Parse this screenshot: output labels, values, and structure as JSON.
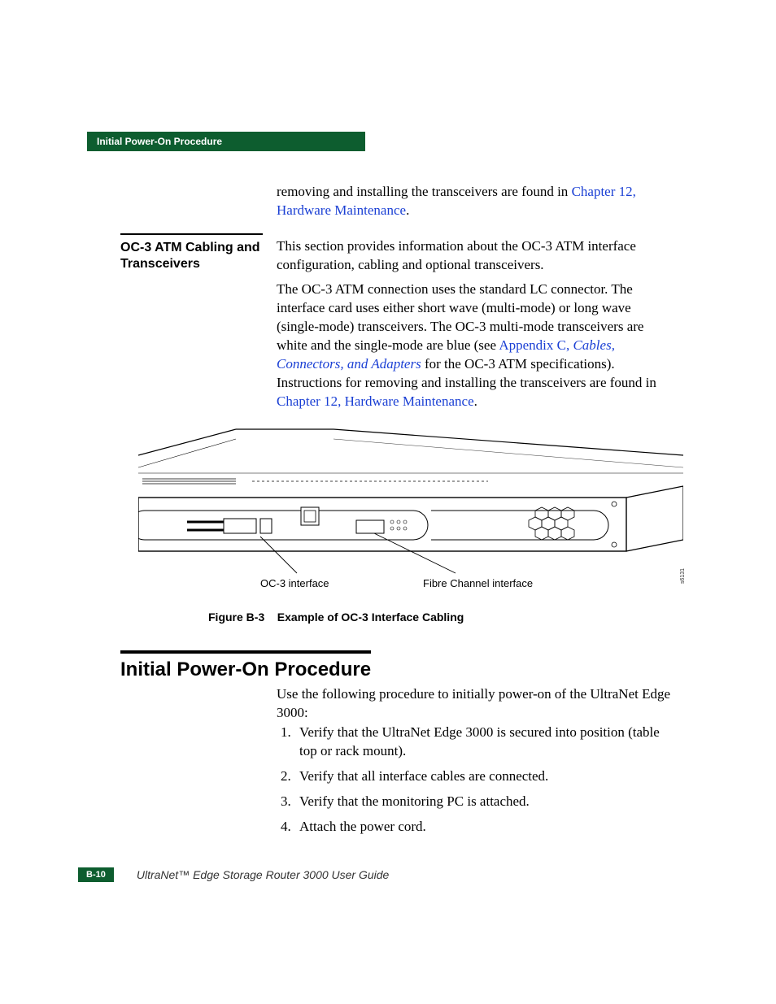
{
  "header": {
    "running_title": "Initial Power-On Procedure"
  },
  "p1": {
    "lead": "removing and installing the transceivers are found in ",
    "link": "Chapter 12, Hardware Maintenance",
    "tail": "."
  },
  "side_heading": "OC-3 ATM Cabling and Transceivers",
  "p2": "This section provides information about the OC-3 ATM interface configuration, cabling and optional transceivers.",
  "p3": {
    "a": "The OC-3 ATM connection uses the standard LC connector. The interface card uses either short wave (multi-mode) or long wave (single-mode) transceivers. The OC-3 multi-mode transceivers are white and the single-mode are blue (see ",
    "link1a": "Appendix C, ",
    "link1b": "Cables, Connectors, and Adapters",
    "b": " for the OC-3 ATM specifications). Instructions for removing and installing the transceivers are found in ",
    "link2": "Chapter 12, Hardware Maintenance",
    "c": "."
  },
  "figure": {
    "callout1": "OC-3 interface",
    "callout2": "Fibre Channel interface",
    "label": "Figure B-3",
    "caption": "Example of OC-3 Interface Cabling",
    "sidenum": "s6131"
  },
  "section_title": "Initial Power-On Procedure",
  "intro": "Use the following procedure to initially power-on of the UltraNet Edge 3000:",
  "steps": [
    "Verify that the UltraNet Edge 3000 is secured into position (table top or rack mount).",
    "Verify that all interface cables are connected.",
    "Verify that the monitoring PC is attached.",
    "Attach the power cord."
  ],
  "footer": {
    "page": "B-10",
    "title": "UltraNet™ Edge Storage Router 3000 User Guide"
  }
}
